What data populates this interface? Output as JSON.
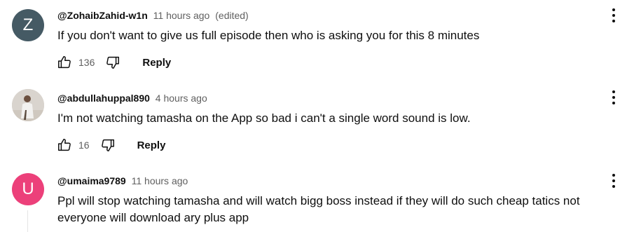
{
  "colors": {
    "avatar_z": "#455a64",
    "avatar_u": "#ec407a",
    "photo_bg": "#d6d0c9",
    "text": "#0f0f0f",
    "secondary": "#606060"
  },
  "comments": [
    {
      "avatar_letter": "Z",
      "author": "@ZohaibZahid-w1n",
      "time": "11 hours ago",
      "edited": "(edited)",
      "text": "If you don't want to give us full episode then who is asking you for this 8 minutes",
      "likes": "136",
      "reply_label": "Reply"
    },
    {
      "avatar_letter": "",
      "author": "@abdullahuppal890",
      "time": "4 hours ago",
      "edited": "",
      "text": "I'm not watching tamasha on the App so bad i can't a single word sound is low.",
      "likes": "16",
      "reply_label": "Reply"
    },
    {
      "avatar_letter": "U",
      "author": "@umaima9789",
      "time": "11 hours ago",
      "edited": "",
      "text": "Ppl will stop watching tamasha and will watch bigg boss instead if they will do such cheap tatics not everyone will download ary plus app",
      "likes": "",
      "reply_label": ""
    }
  ],
  "icons": {
    "like": "thumb-up-icon",
    "dislike": "thumb-down-icon",
    "more": "more-vertical-icon"
  }
}
